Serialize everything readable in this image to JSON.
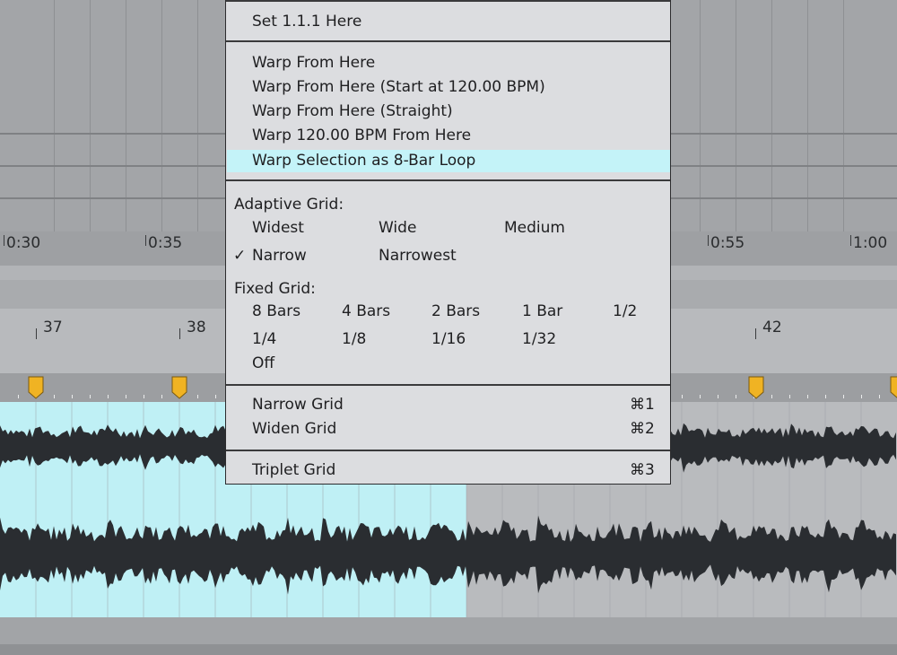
{
  "time_ruler": [
    "0:30",
    "0:35",
    "0:55",
    "1:00"
  ],
  "beat_ruler": [
    "37",
    "38",
    "42"
  ],
  "menu": {
    "set_here": "Set 1.1.1 Here",
    "warp_from_here": "Warp From Here",
    "warp_from_here_start": "Warp From Here (Start at 120.00 BPM)",
    "warp_from_here_straight": "Warp From Here (Straight)",
    "warp_bpm_from_here": "Warp 120.00 BPM From Here",
    "warp_selection_loop": "Warp Selection as 8-Bar Loop",
    "adaptive_grid_label": "Adaptive Grid:",
    "adaptive": {
      "widest": "Widest",
      "wide": "Wide",
      "medium": "Medium",
      "narrow": "Narrow",
      "narrowest": "Narrowest",
      "checkmark": "✓"
    },
    "fixed_grid_label": "Fixed Grid:",
    "fixed": [
      "8 Bars",
      "4 Bars",
      "2 Bars",
      "1 Bar",
      "1/2",
      "1/4",
      "1/8",
      "1/16",
      "1/32",
      "Off"
    ],
    "narrow_grid": "Narrow Grid",
    "narrow_grid_shortcut": "⌘1",
    "widen_grid": "Widen Grid",
    "widen_grid_shortcut": "⌘2",
    "triplet_grid": "Triplet Grid",
    "triplet_grid_shortcut": "⌘3"
  },
  "colors": {
    "selection": "#bff0f5",
    "highlight": "#c4f3f8",
    "warp_marker": "#f0b323",
    "waveform": "#2a2d31"
  }
}
